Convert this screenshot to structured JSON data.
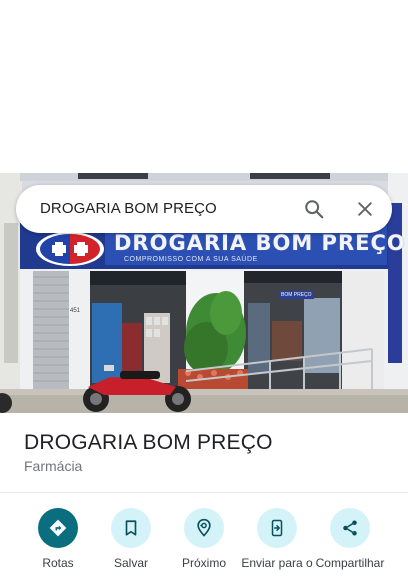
{
  "colors": {
    "primary_circle": "#0b6e7e",
    "secondary_circle": "#d3f3f9",
    "icon_dark": "#0b4f5c"
  },
  "search": {
    "query": "DROGARIA BOM PREÇO",
    "search_icon": "search-icon",
    "clear_icon": "close-icon"
  },
  "photo": {
    "sign_text": "DROGARIA BOM PREÇO",
    "sign_subtitle": "COMPROMISSO COM A SUA SAÚDE",
    "door_number": "451",
    "door_sign": "BOM PREÇO"
  },
  "place": {
    "title": "DROGARIA BOM PREÇO",
    "category": "Farmácia"
  },
  "actions": [
    {
      "label": "Rotas",
      "icon": "directions-icon",
      "primary": true
    },
    {
      "label": "Salvar",
      "icon": "bookmark-icon",
      "primary": false
    },
    {
      "label": "Próximo",
      "icon": "nearby-icon",
      "primary": false
    },
    {
      "label": "Enviar para o",
      "icon": "send-to-phone-icon",
      "primary": false
    },
    {
      "label": "Compartilhar",
      "icon": "share-icon",
      "primary": false
    }
  ]
}
